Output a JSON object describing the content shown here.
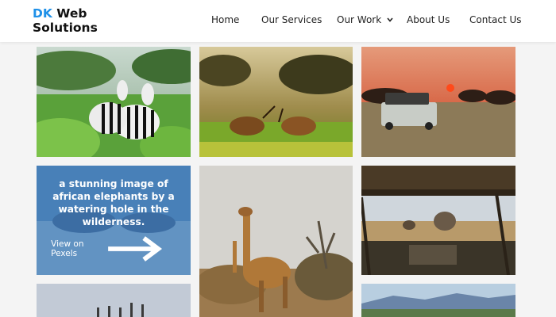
{
  "brand": {
    "accent": "DK",
    "rest_line1": " Web",
    "line2": "Solutions",
    "accent_color": "#1e90e8"
  },
  "nav": {
    "home": "Home",
    "services": "Our Services",
    "work": "Our Work",
    "about": "About Us",
    "contact": "Contact Us"
  },
  "gallery": {
    "overlay_caption": "a stunning image of african elephants by a watering hole in the wilderness.",
    "overlay_link": "View on Pexels",
    "images": [
      "zebras",
      "antelopes-fighting",
      "safari-jeep-sunset",
      "elephants-watering-hole",
      "giraffes",
      "safari-vehicle-interior",
      "flamingos",
      "savanna-hills"
    ]
  }
}
